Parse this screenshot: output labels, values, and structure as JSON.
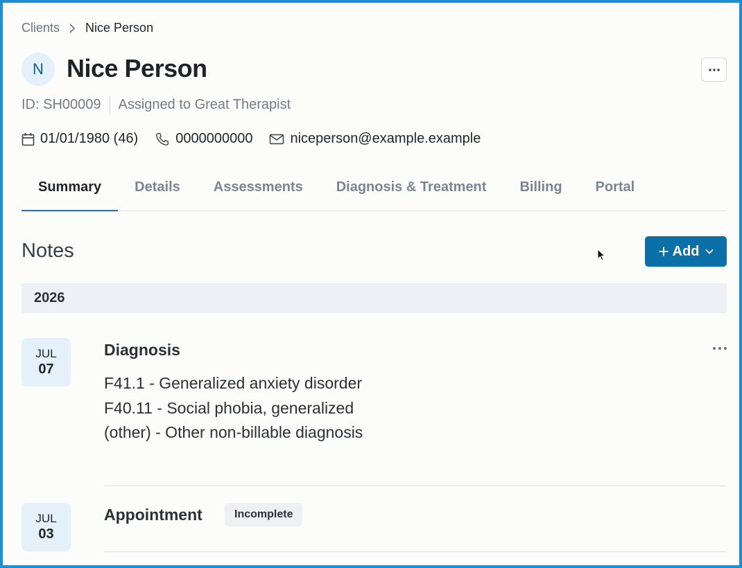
{
  "breadcrumb": {
    "parent": "Clients",
    "current": "Nice Person"
  },
  "client": {
    "avatar_letter": "N",
    "name": "Nice Person",
    "id_label": "ID: SH00009",
    "assigned": "Assigned to Great Therapist",
    "dob": "01/01/1980 (46)",
    "phone": "0000000000",
    "email": "niceperson@example.example"
  },
  "tabs": [
    {
      "label": "Summary",
      "active": true
    },
    {
      "label": "Details",
      "active": false
    },
    {
      "label": "Assessments",
      "active": false
    },
    {
      "label": "Diagnosis & Treatment",
      "active": false
    },
    {
      "label": "Billing",
      "active": false
    },
    {
      "label": "Portal",
      "active": false
    }
  ],
  "notes": {
    "title": "Notes",
    "add_label": "Add",
    "year": "2026",
    "entries": [
      {
        "month": "JUL",
        "day": "07",
        "title": "Diagnosis",
        "lines": [
          "F41.1 - Generalized anxiety disorder",
          "F40.11 - Social phobia, generalized",
          "(other) - Other non-billable diagnosis"
        ]
      },
      {
        "month": "JUL",
        "day": "03",
        "title": "Appointment",
        "badge": "Incomplete"
      }
    ]
  },
  "colors": {
    "accent": "#0b6fa8",
    "frame": "#1a8fd6",
    "chip_bg": "#e4f1fb"
  }
}
